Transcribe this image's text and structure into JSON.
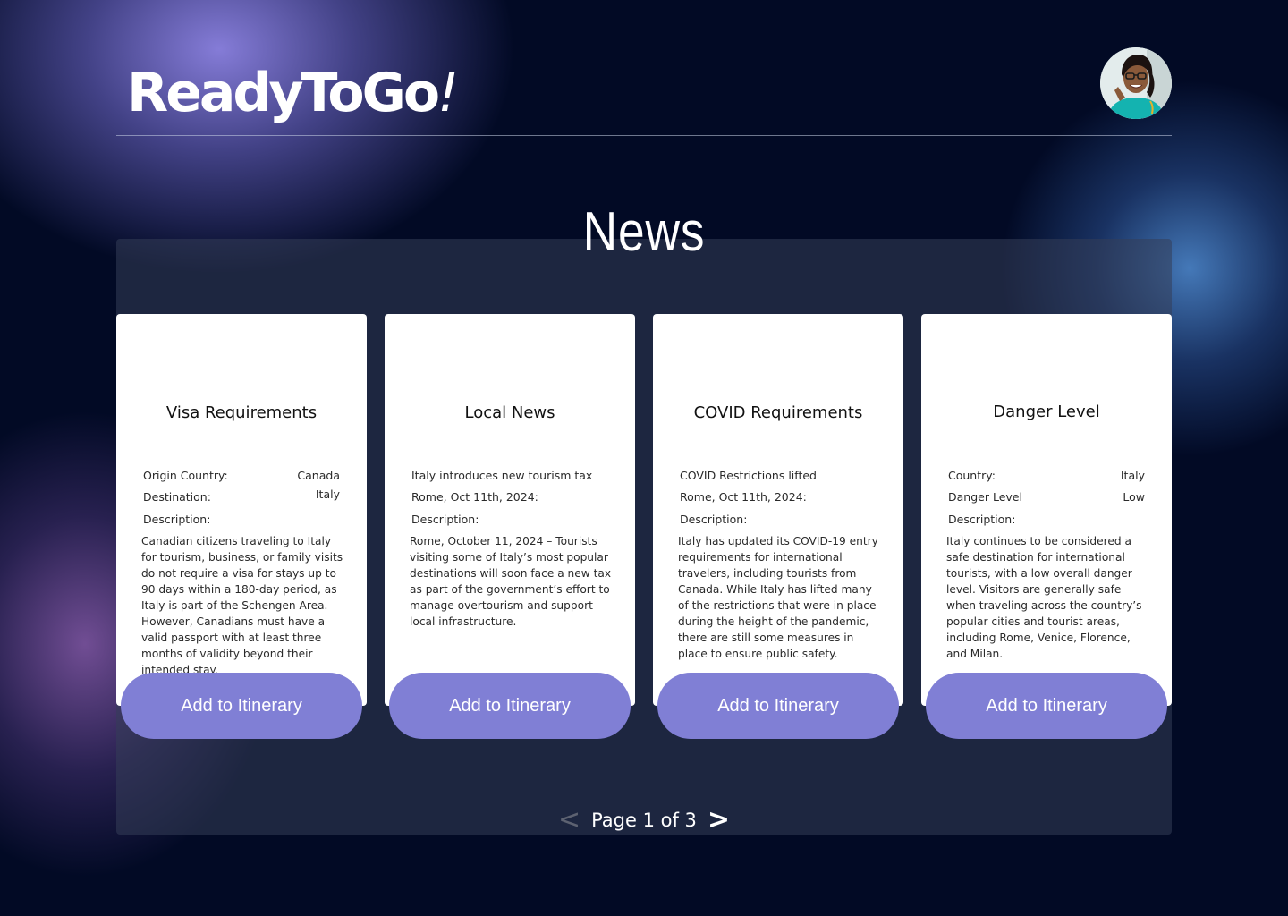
{
  "app": {
    "logo_text": "ReadyToGo",
    "logo_mark": "!"
  },
  "header": {
    "avatar_icon": "user-avatar-icon"
  },
  "page": {
    "title": "News"
  },
  "cards": [
    {
      "title": "Visa Requirements",
      "rows": [
        {
          "key": "Origin Country:",
          "value": "Canada"
        },
        {
          "key": "Destination:",
          "value": "Italy"
        },
        {
          "key": "Description:",
          "value": ""
        }
      ],
      "description": "Canadian citizens traveling to Italy for tourism, business, or family visits do not require a visa for stays up to 90 days within a 180-day period, as Italy is part of the Schengen Area. However, Canadians must have a valid passport with at least three months of validity beyond their intended stay.",
      "button_label": "Add to Itinerary"
    },
    {
      "title": "Local News",
      "rows": [
        {
          "key": "Italy introduces new tourism tax",
          "value": ""
        },
        {
          "key": "Rome, Oct 11th, 2024:",
          "value": ""
        },
        {
          "key": "Description:",
          "value": ""
        }
      ],
      "description": "Rome, October 11, 2024 – Tourists visiting some of Italy’s most popular destinations will soon face a new tax as part of the government’s effort to manage overtourism and support local infrastructure.",
      "button_label": "Add to Itinerary"
    },
    {
      "title": "COVID Requirements",
      "rows": [
        {
          "key": "COVID Restrictions lifted",
          "value": ""
        },
        {
          "key": "Rome, Oct 11th, 2024:",
          "value": ""
        },
        {
          "key": "Description:",
          "value": ""
        }
      ],
      "description": "Italy has updated its COVID-19 entry requirements for international travelers, including tourists from Canada. While Italy has lifted many of the restrictions that were in place during the height of the pandemic, there are still some measures in place to ensure public safety.",
      "button_label": "Add to Itinerary"
    },
    {
      "title": "Danger Level",
      "rows": [
        {
          "key": "Country:",
          "value": "Italy"
        },
        {
          "key": "Danger Level",
          "value": "Low"
        },
        {
          "key": "Description:",
          "value": ""
        }
      ],
      "description": "Italy continues to be considered a safe destination for international tourists, with a low overall danger level. Visitors are generally safe when traveling across the country’s popular cities and tourist areas, including Rome, Venice, Florence, and Milan.",
      "button_label": "Add to Itinerary"
    }
  ],
  "pagination": {
    "label": "Page 1 of 3",
    "prev_glyph": "<",
    "next_glyph": ">",
    "prev_icon": "chevron-left-icon",
    "next_icon": "chevron-right-icon"
  },
  "colors": {
    "background": "#020a25",
    "accent_button": "#807fd5",
    "card": "#ffffff"
  }
}
